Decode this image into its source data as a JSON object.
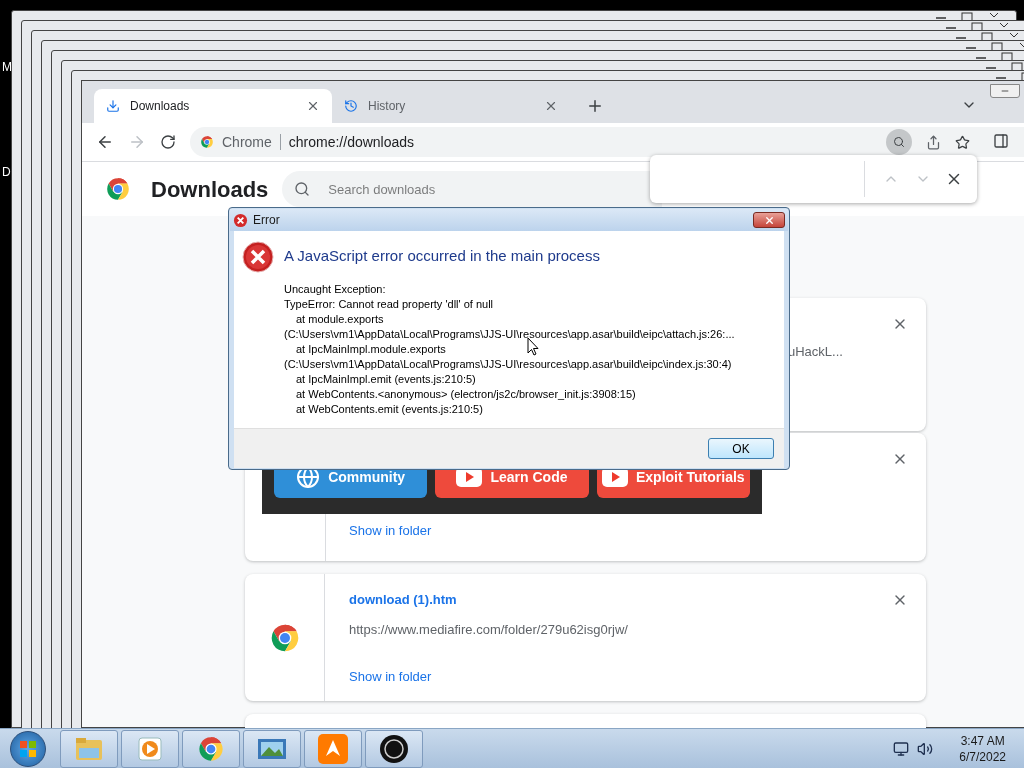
{
  "desktop": {
    "labels": [
      "M",
      "D"
    ]
  },
  "trail_windows": [
    {
      "kind": "frame"
    },
    {
      "kind": "frame"
    },
    {
      "kind": "frame"
    },
    {
      "kind": "frame"
    },
    {
      "kind": "frame"
    },
    {
      "kind": "frame"
    },
    {
      "kind": "frame"
    }
  ],
  "browser": {
    "tabs": [
      {
        "label": "Downloads",
        "kind": "download",
        "selected": true
      },
      {
        "label": "History",
        "kind": "history",
        "selected": false
      }
    ],
    "address": {
      "chip": "Chrome",
      "url": "chrome://downloads"
    },
    "page": {
      "title": "Downloads",
      "search_placeholder": "Search downloads"
    },
    "downloads": [
      {
        "kind": "partial",
        "text": "uHackL..."
      },
      {
        "kind": "banner",
        "buttons": [
          {
            "label": "Community",
            "kind": "globe"
          },
          {
            "label": "Learn Code",
            "kind": "video"
          },
          {
            "label": "Exploit Tutorials",
            "kind": "video"
          }
        ],
        "link": "Show in folder"
      },
      {
        "kind": "file",
        "name": "download (1).htm",
        "url": "https://www.mediafire.com/folder/279u62isg0rjw/",
        "link": "Show in folder"
      },
      {
        "kind": "cut"
      }
    ]
  },
  "dialog": {
    "title": "Error",
    "heading": "A JavaScript error occurred in the main process",
    "lines": [
      {
        "text": "Uncaught Exception:",
        "indent": false
      },
      {
        "text": "TypeError: Cannot read property 'dll' of null",
        "indent": false
      },
      {
        "text": "at module.exports",
        "indent": true
      },
      {
        "text": "(C:\\Users\\vm1\\AppData\\Local\\Programs\\JJS-UI\\resources\\app.asar\\build\\eipc\\attach.js:26:...",
        "indent": false
      },
      {
        "text": "at IpcMainImpl.module.exports",
        "indent": true
      },
      {
        "text": "(C:\\Users\\vm1\\AppData\\Local\\Programs\\JJS-UI\\resources\\app.asar\\build\\eipc\\index.js:30:4)",
        "indent": false
      },
      {
        "text": "at IpcMainImpl.emit (events.js:210:5)",
        "indent": true
      },
      {
        "text": "at WebContents.<anonymous> (electron/js2c/browser_init.js:3908:15)",
        "indent": true
      },
      {
        "text": "at WebContents.emit (events.js:210:5)",
        "indent": true
      }
    ],
    "button": "OK"
  },
  "taskbar": {
    "apps": [
      {
        "kind": "folder"
      },
      {
        "kind": "media"
      },
      {
        "kind": "chrome"
      },
      {
        "kind": "photos"
      },
      {
        "kind": "avast"
      },
      {
        "kind": "wrd"
      }
    ],
    "time": "3:47 AM",
    "date": "6/7/2022"
  }
}
